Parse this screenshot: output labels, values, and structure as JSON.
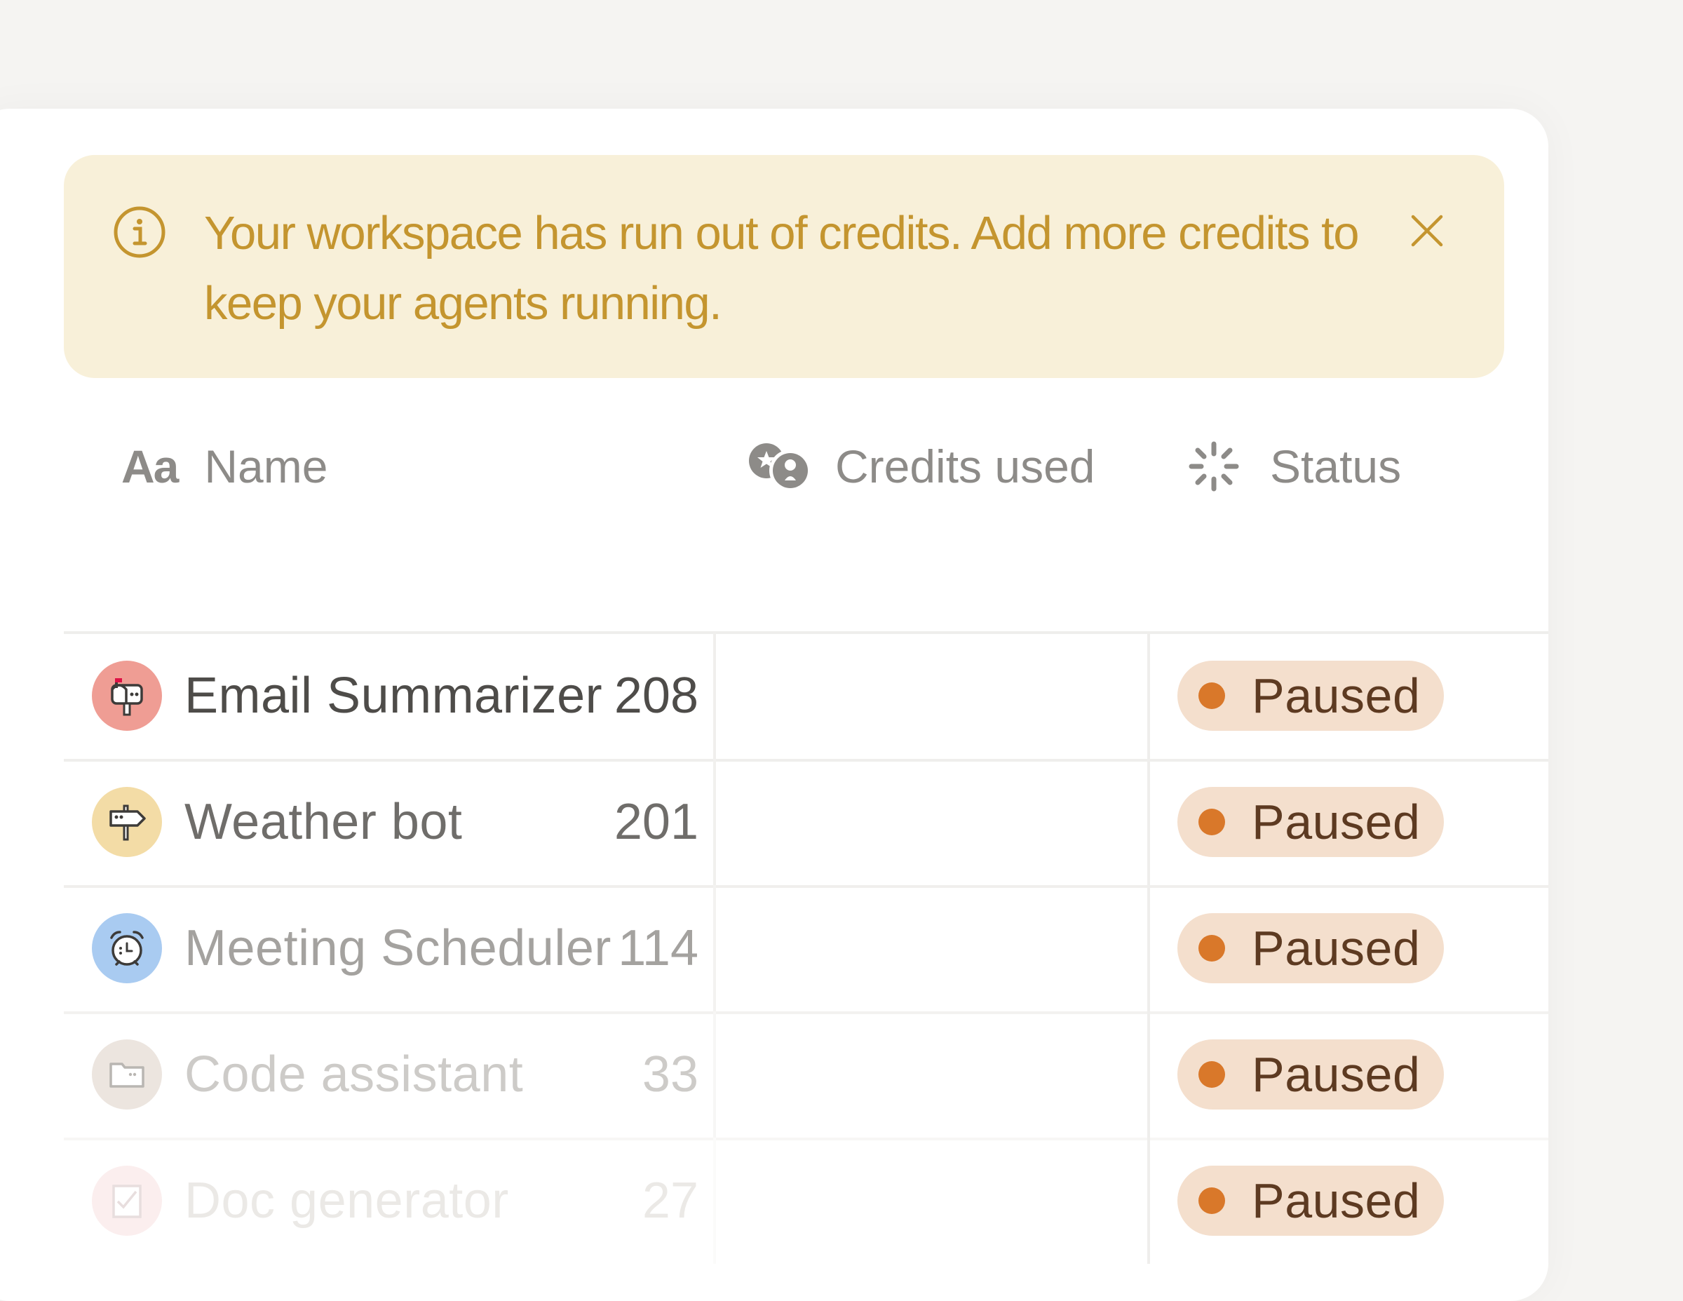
{
  "banner": {
    "message": "Your workspace has run out of credits. Add more credits to keep your agents running.",
    "icons": {
      "info": "info-circle-icon",
      "close": "close-icon"
    },
    "colors": {
      "background": "#f8f0d9",
      "text": "#c4952f"
    }
  },
  "table": {
    "columns": {
      "name": {
        "icon_text": "Aa",
        "label": "Name"
      },
      "credits": {
        "icon": "credits-icon",
        "label": "Credits used"
      },
      "status": {
        "icon": "status-loader-icon",
        "label": "Status"
      }
    },
    "rows": [
      {
        "name": "Email Summarizer",
        "credits": "208",
        "status": "Paused",
        "icon": "mailbox-icon",
        "avatar_color": "#ef9d94",
        "text_color": "#4e4c49"
      },
      {
        "name": "Weather bot",
        "credits": "201",
        "status": "Paused",
        "icon": "signpost-icon",
        "avatar_color": "#f3dca6",
        "text_color": "#6f6d6a"
      },
      {
        "name": "Meeting Scheduler",
        "credits": "114",
        "status": "Paused",
        "icon": "alarm-clock-icon",
        "avatar_color": "#a9cbf1",
        "text_color": "#a4a29f"
      },
      {
        "name": "Code assistant",
        "credits": "33",
        "status": "Paused",
        "icon": "folder-icon",
        "avatar_color": "#ece5df",
        "text_color": "#cdcbc8"
      },
      {
        "name": "Doc generator",
        "credits": "27",
        "status": "Paused",
        "icon": "checklist-icon",
        "avatar_color": "#fbeeee",
        "text_color": "#ebe9e6"
      }
    ],
    "status_colors": {
      "badge": "#f4dfcd",
      "dot": "#d9782a",
      "text": "#5d3a21"
    }
  }
}
